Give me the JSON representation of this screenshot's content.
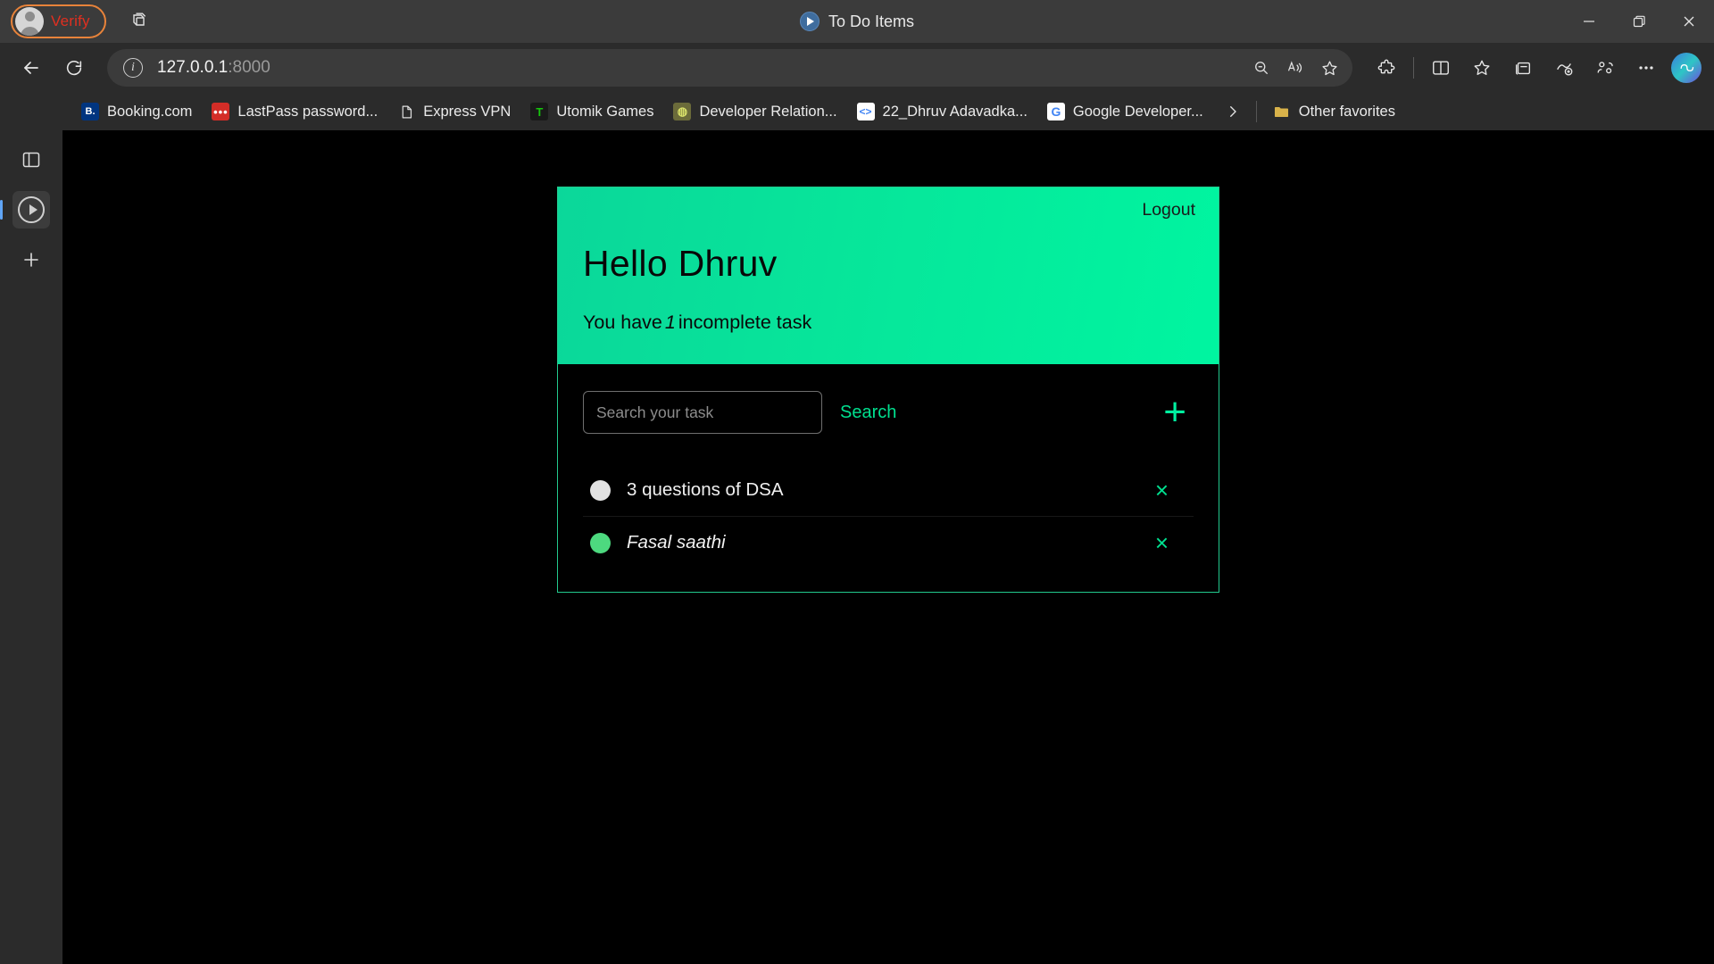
{
  "browser": {
    "profile": {
      "label": "Verify",
      "icon": "avatar-icon",
      "outline_color": "#e8833a",
      "text_color": "#e02f20"
    },
    "workspaces_icon": "workspaces-icon",
    "tab": {
      "title": "To Do Items",
      "favicon": "play-circle-icon"
    },
    "window_controls": {
      "minimize": "minimize-icon",
      "maximize": "restore-icon",
      "close": "close-icon"
    },
    "nav": {
      "back": "back-arrow-icon",
      "refresh": "refresh-icon",
      "site_info": "info-icon",
      "url_host": "127.0.0.1",
      "url_port": ":8000",
      "url_full": "127.0.0.1:8000",
      "address_actions": [
        "zoom-out-icon",
        "read-aloud-icon",
        "favorite-star-icon"
      ],
      "toolbar": [
        "extensions-icon",
        "split-screen-icon",
        "favorites-icon",
        "collections-icon",
        "browser-essentials-icon",
        "profile-switch-icon",
        "settings-more-icon"
      ],
      "copilot": "copilot-icon"
    },
    "bookmarks": [
      {
        "label": "Booking.com",
        "icon": "booking-icon",
        "glyph": "B."
      },
      {
        "label": "LastPass password...",
        "icon": "lastpass-icon",
        "glyph": "•••"
      },
      {
        "label": "Express VPN",
        "icon": "document-icon",
        "glyph": ""
      },
      {
        "label": "Utomik Games",
        "icon": "utomik-icon",
        "glyph": "T"
      },
      {
        "label": "Developer Relation...",
        "icon": "avocado-icon",
        "glyph": "◍"
      },
      {
        "label": "22_Dhruv Adavadka...",
        "icon": "code-icon",
        "glyph": "<>"
      },
      {
        "label": "Google Developer...",
        "icon": "google-icon",
        "glyph": "G"
      }
    ],
    "bookmarks_overflow_icon": "chevron-right-icon",
    "other_favorites": {
      "label": "Other favorites",
      "icon": "folder-icon"
    },
    "left_rail": {
      "tab_actions_icon": "split-pane-icon",
      "active_site_icon": "play-circle-icon",
      "add_icon": "plus-icon"
    }
  },
  "app": {
    "header": {
      "logout_label": "Logout",
      "greeting": "Hello Dhruv",
      "subline_prefix": "You have",
      "incomplete_count": "1",
      "subline_suffix": "incomplete task",
      "gradient_from": "#0bd79a",
      "gradient_to": "#00f5a0"
    },
    "search": {
      "placeholder": "Search your task",
      "value": "",
      "button_label": "Search",
      "add_label": "+",
      "accent_color": "#00e08f"
    },
    "tasks": [
      {
        "text": "3 questions of DSA",
        "completed": false,
        "status_color": "#e2e2e2",
        "delete_icon": "close-icon",
        "delete_label": "×"
      },
      {
        "text": "Fasal saathi",
        "completed": true,
        "status_color": "#4dd97f",
        "delete_icon": "close-icon",
        "delete_label": "×"
      }
    ]
  }
}
